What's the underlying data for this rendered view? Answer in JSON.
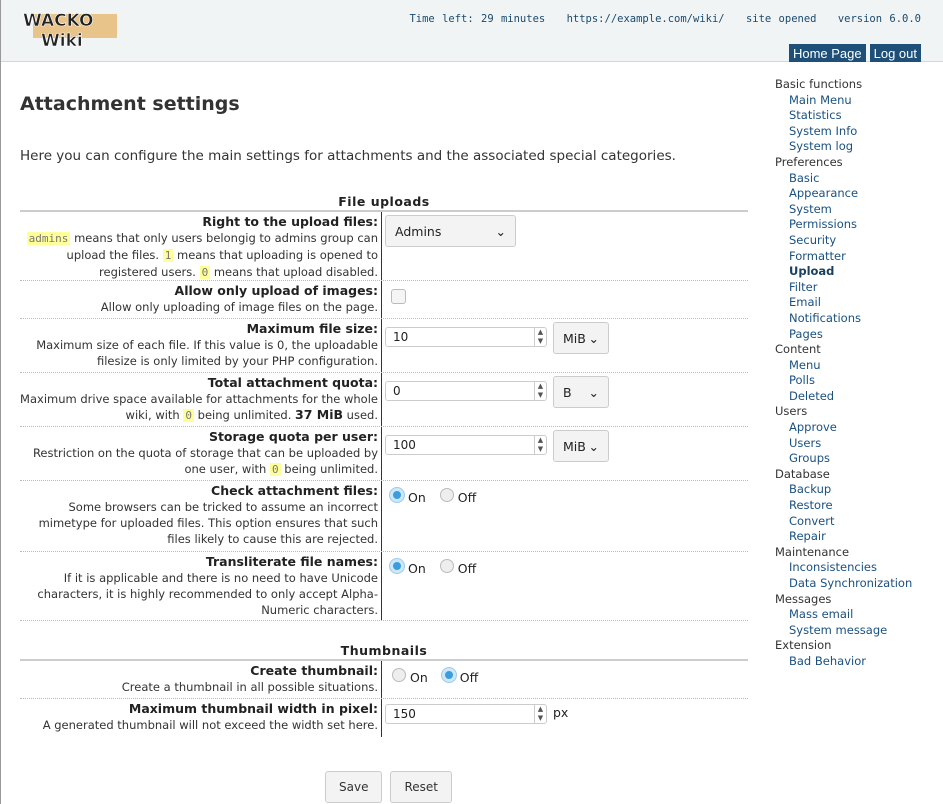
{
  "header": {
    "logo_text": "WackoWiki",
    "time_left": "Time left: 29 minutes",
    "url": "https://example.com/wiki/",
    "status": "site opened",
    "version": "version 6.0.0",
    "home_page": "Home Page",
    "log_out": "Log out"
  },
  "page": {
    "title": "Attachment settings",
    "intro": "Here you can configure the main settings for attachments and the associated special categories."
  },
  "sections": {
    "uploads": "File uploads",
    "thumbnails": "Thumbnails"
  },
  "rows": {
    "upload_right": {
      "label": "Right to the upload files:",
      "d1": "admins",
      "d2": " means that only users belongig to admins group can upload the files. ",
      "d3": "1",
      "d4": " means that uploading is opened to registered users. ",
      "d5": "0",
      "d6": " means that upload disabled.",
      "value": "Admins"
    },
    "images_only": {
      "label": "Allow only upload of images:",
      "desc": "Allow only uploading of image files on the page.",
      "checked": false
    },
    "max_size": {
      "label": "Maximum file size:",
      "desc": "Maximum size of each file. If this value is 0, the uploadable filesize is only limited by your PHP configuration.",
      "value": "10",
      "unit": "MiB"
    },
    "total_quota": {
      "label": "Total attachment quota:",
      "d1": "Maximum drive space available for attachments for the whole wiki, with ",
      "d2": "0",
      "d3": " being unlimited. ",
      "d4": "37 MiB",
      "d5": " used.",
      "value": "0",
      "unit": "B"
    },
    "user_quota": {
      "label": "Storage quota per user:",
      "d1": "Restriction on the quota of storage that can be uploaded by one user, with ",
      "d2": "0",
      "d3": " being unlimited.",
      "value": "100",
      "unit": "MiB"
    },
    "check_files": {
      "label": "Check attachment files:",
      "desc": "Some browsers can be tricked to assume an incorrect mimetype for uploaded files. This option ensures that such files likely to cause this are rejected.",
      "on": "On",
      "off": "Off",
      "selected": "On"
    },
    "translit": {
      "label": "Transliterate file names:",
      "desc": "If it is applicable and there is no need to have Unicode characters, it is highly recommended to only accept Alpha-Numeric characters.",
      "on": "On",
      "off": "Off",
      "selected": "On"
    },
    "create_thumb": {
      "label": "Create thumbnail:",
      "desc": "Create a thumbnail in all possible situations.",
      "on": "On",
      "off": "Off",
      "selected": "Off"
    },
    "thumb_width": {
      "label": "Maximum thumbnail width in pixel:",
      "desc": "A generated thumbnail will not exceed the width set here.",
      "value": "150",
      "unit": "px"
    }
  },
  "buttons": {
    "save": "Save",
    "reset": "Reset"
  },
  "sidebar": [
    {
      "t": "Basic functions",
      "g": 1
    },
    {
      "t": "Main Menu"
    },
    {
      "t": "Statistics"
    },
    {
      "t": "System Info"
    },
    {
      "t": "System log"
    },
    {
      "t": "Preferences",
      "g": 1
    },
    {
      "t": "Basic"
    },
    {
      "t": "Appearance"
    },
    {
      "t": "System"
    },
    {
      "t": "Permissions"
    },
    {
      "t": "Security"
    },
    {
      "t": "Formatter"
    },
    {
      "t": "Upload",
      "active": 1
    },
    {
      "t": "Filter"
    },
    {
      "t": "Email"
    },
    {
      "t": "Notifications"
    },
    {
      "t": "Pages"
    },
    {
      "t": "Content",
      "g": 1
    },
    {
      "t": "Menu"
    },
    {
      "t": "Polls"
    },
    {
      "t": "Deleted"
    },
    {
      "t": "Users",
      "g": 1
    },
    {
      "t": "Approve"
    },
    {
      "t": "Users"
    },
    {
      "t": "Groups"
    },
    {
      "t": "Database",
      "g": 1
    },
    {
      "t": "Backup"
    },
    {
      "t": "Restore"
    },
    {
      "t": "Convert"
    },
    {
      "t": "Repair"
    },
    {
      "t": "Maintenance",
      "g": 1
    },
    {
      "t": "Inconsistencies"
    },
    {
      "t": "Data Synchronization"
    },
    {
      "t": "Messages",
      "g": 1
    },
    {
      "t": "Mass email"
    },
    {
      "t": "System message"
    },
    {
      "t": "Extension",
      "g": 1
    },
    {
      "t": "Bad Behavior"
    }
  ],
  "colors": {
    "accent": "#1d4f78",
    "highlight": "#ffff99",
    "divider": "#aa0000"
  }
}
